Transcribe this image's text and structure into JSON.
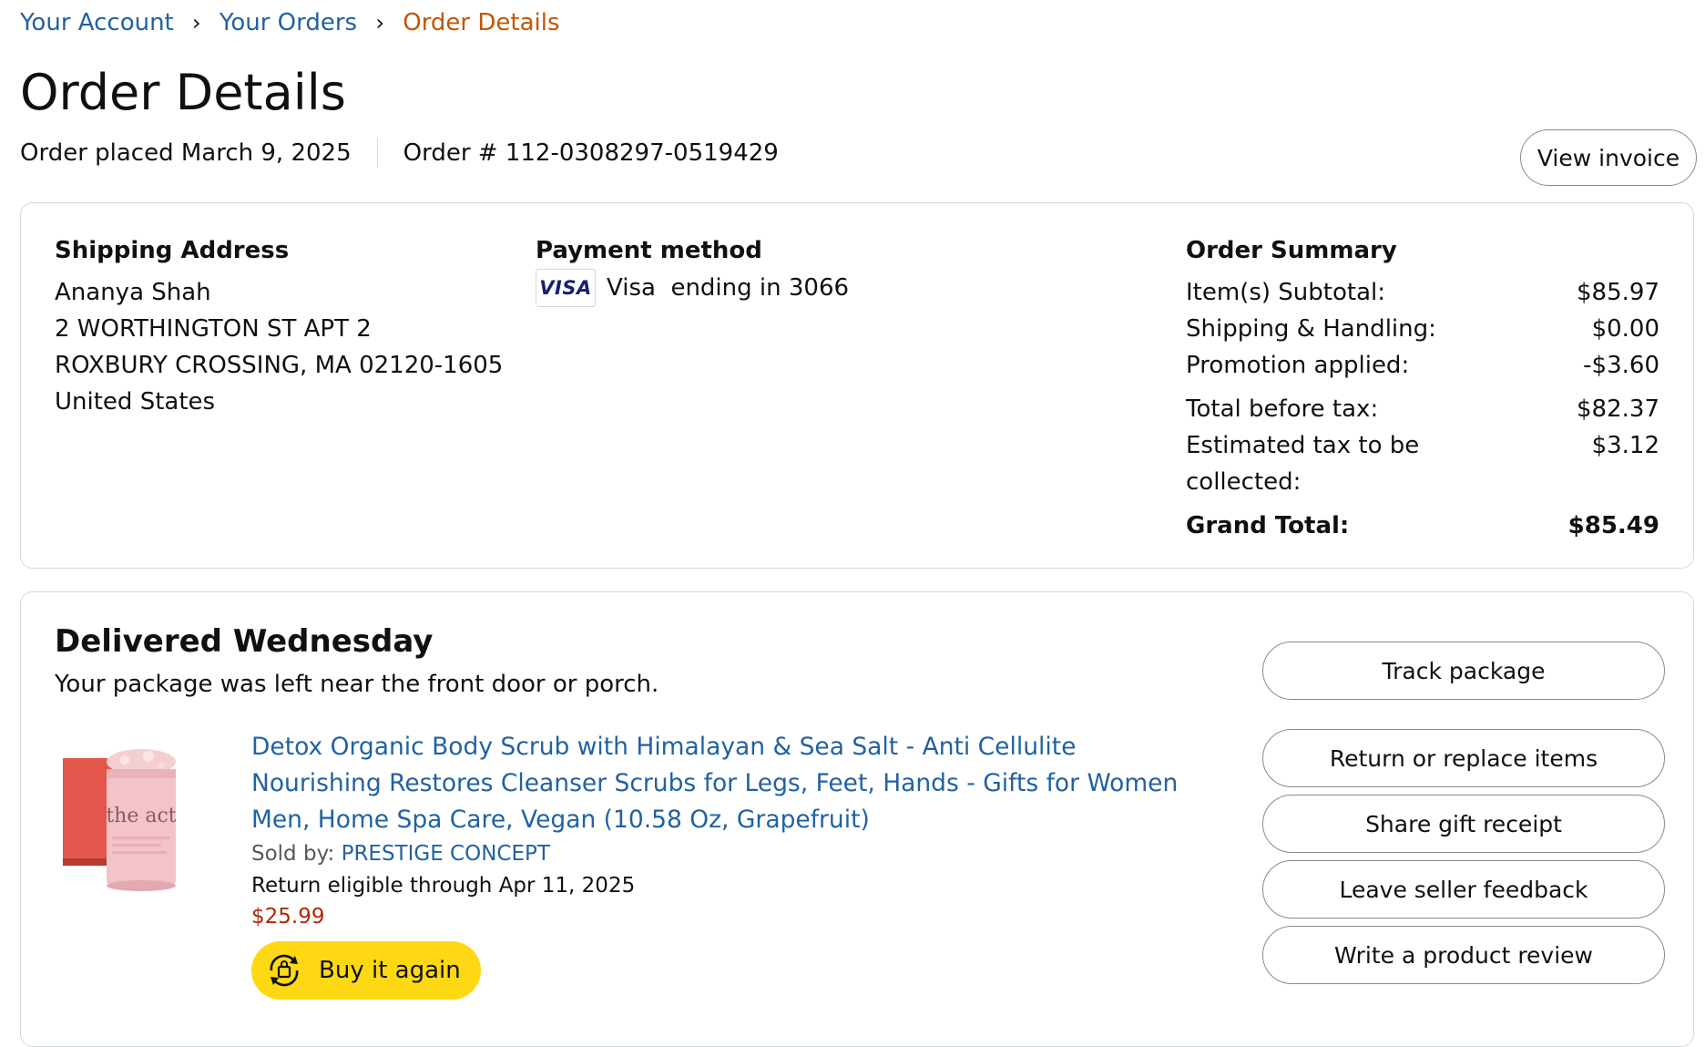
{
  "breadcrumb": {
    "items": [
      "Your Account",
      "Your Orders"
    ],
    "separator": "›",
    "current": "Order Details"
  },
  "page_title": "Order Details",
  "order_meta": {
    "placed": "Order placed March 9, 2025",
    "number": "Order # 112-0308297-0519429"
  },
  "view_invoice_label": "View invoice",
  "shipping": {
    "heading": "Shipping Address",
    "name": "Ananya Shah",
    "line1": "2 WORTHINGTON ST APT 2",
    "line2": "ROXBURY CROSSING, MA 02120-1605",
    "country": "United States"
  },
  "payment": {
    "heading": "Payment method",
    "card_brand": "VISA",
    "card_text": "Visa  ending in 3066",
    "brand_color": "#1a1f71"
  },
  "summary": {
    "heading": "Order Summary",
    "subtotal_label": "Item(s) Subtotal:",
    "subtotal_value": "$85.97",
    "shipping_label": "Shipping & Handling:",
    "shipping_value": "$0.00",
    "promo_label": "Promotion applied:",
    "promo_value": "-$3.60",
    "before_tax_label": "Total before tax:",
    "before_tax_value": "$82.37",
    "tax_label": "Estimated tax to be collected:",
    "tax_value": "$3.12",
    "grand_label": "Grand Total:",
    "grand_value": "$85.49"
  },
  "shipment": {
    "status": "Delivered Wednesday",
    "note": "Your package was left near the front door or porch.",
    "product": {
      "title": "Detox Organic Body Scrub with Himalayan & Sea Salt - Anti Cellulite Nourishing Restores Cleanser Scrubs for Legs, Feet, Hands - Gifts for Women Men, Home Spa Care, Vegan (10.58 Oz, Grapefruit)",
      "sold_by_label": "Sold by:",
      "seller": "PRESTIGE CONCEPT",
      "return_eligibility": "Return eligible through Apr 11, 2025",
      "price": "$25.99",
      "image_brand_text": "the act"
    },
    "buy_again_label": "Buy it again",
    "actions": [
      "Track package",
      "Return or replace items",
      "Share gift receipt",
      "Leave seller feedback",
      "Write a product review"
    ]
  },
  "colors": {
    "link": "#2162a1",
    "breadcrumb_current": "#c45500",
    "price": "#b12704",
    "buy_again_bg": "#ffd814",
    "border": "#d5d9d9"
  }
}
